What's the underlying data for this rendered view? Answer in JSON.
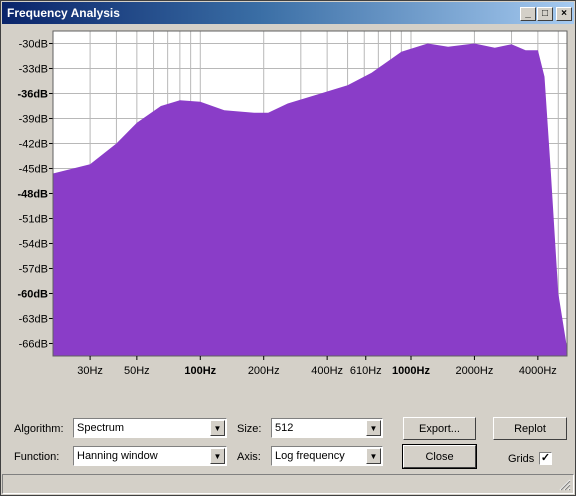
{
  "window": {
    "title": "Frequency Analysis"
  },
  "titlebar_buttons": {
    "minimize": "_",
    "maximize": "□",
    "close": "×"
  },
  "chart_data": {
    "type": "area",
    "color": "#8a3dc8",
    "x_scale": "log",
    "xlim": [
      20,
      5500
    ],
    "ylim": [
      -67.5,
      -28.5
    ],
    "grid": true,
    "y_ticks": [
      {
        "value": -30,
        "label": "-30dB",
        "bold": false
      },
      {
        "value": -33,
        "label": "-33dB",
        "bold": false
      },
      {
        "value": -36,
        "label": "-36dB",
        "bold": true
      },
      {
        "value": -39,
        "label": "-39dB",
        "bold": false
      },
      {
        "value": -42,
        "label": "-42dB",
        "bold": false
      },
      {
        "value": -45,
        "label": "-45dB",
        "bold": false
      },
      {
        "value": -48,
        "label": "-48dB",
        "bold": true
      },
      {
        "value": -51,
        "label": "-51dB",
        "bold": false
      },
      {
        "value": -54,
        "label": "-54dB",
        "bold": false
      },
      {
        "value": -57,
        "label": "-57dB",
        "bold": false
      },
      {
        "value": -60,
        "label": "-60dB",
        "bold": true
      },
      {
        "value": -63,
        "label": "-63dB",
        "bold": false
      },
      {
        "value": -66,
        "label": "-66dB",
        "bold": false
      }
    ],
    "x_ticks": [
      {
        "value": 30,
        "label": "30Hz",
        "bold": false
      },
      {
        "value": 50,
        "label": "50Hz",
        "bold": false
      },
      {
        "value": 100,
        "label": "100Hz",
        "bold": true
      },
      {
        "value": 200,
        "label": "200Hz",
        "bold": false
      },
      {
        "value": 400,
        "label": "400Hz",
        "bold": false
      },
      {
        "value": 610,
        "label": "610Hz",
        "bold": false
      },
      {
        "value": 1000,
        "label": "1000Hz",
        "bold": true
      },
      {
        "value": 2000,
        "label": "2000Hz",
        "bold": false
      },
      {
        "value": 4000,
        "label": "4000Hz",
        "bold": false
      }
    ],
    "x_gridlines": [
      20,
      30,
      40,
      50,
      60,
      70,
      80,
      90,
      100,
      200,
      300,
      400,
      500,
      600,
      700,
      800,
      900,
      1000,
      2000,
      3000,
      4000,
      5000
    ],
    "points": [
      [
        20,
        -45.6
      ],
      [
        30,
        -44.5
      ],
      [
        40,
        -42
      ],
      [
        50,
        -39.5
      ],
      [
        65,
        -37.5
      ],
      [
        80,
        -36.8
      ],
      [
        100,
        -37
      ],
      [
        130,
        -38
      ],
      [
        180,
        -38.3
      ],
      [
        210,
        -38.3
      ],
      [
        260,
        -37.2
      ],
      [
        350,
        -36.2
      ],
      [
        500,
        -35
      ],
      [
        650,
        -33.5
      ],
      [
        900,
        -31
      ],
      [
        1200,
        -30
      ],
      [
        1500,
        -30.4
      ],
      [
        2000,
        -30
      ],
      [
        2500,
        -30.5
      ],
      [
        3000,
        -30.1
      ],
      [
        3500,
        -30.8
      ],
      [
        4000,
        -30.8
      ],
      [
        4300,
        -34
      ],
      [
        4600,
        -45
      ],
      [
        5000,
        -60
      ],
      [
        5500,
        -66.5
      ]
    ]
  },
  "controls": {
    "algorithm_label": "Algorithm:",
    "algorithm_value": "Spectrum",
    "function_label": "Function:",
    "function_value": "Hanning window",
    "size_label": "Size:",
    "size_value": "512",
    "axis_label": "Axis:",
    "axis_value": "Log frequency",
    "export_label": "Export...",
    "close_label": "Close",
    "replot_label": "Replot",
    "grids_label": "Grids",
    "grids_checked": "✓"
  }
}
